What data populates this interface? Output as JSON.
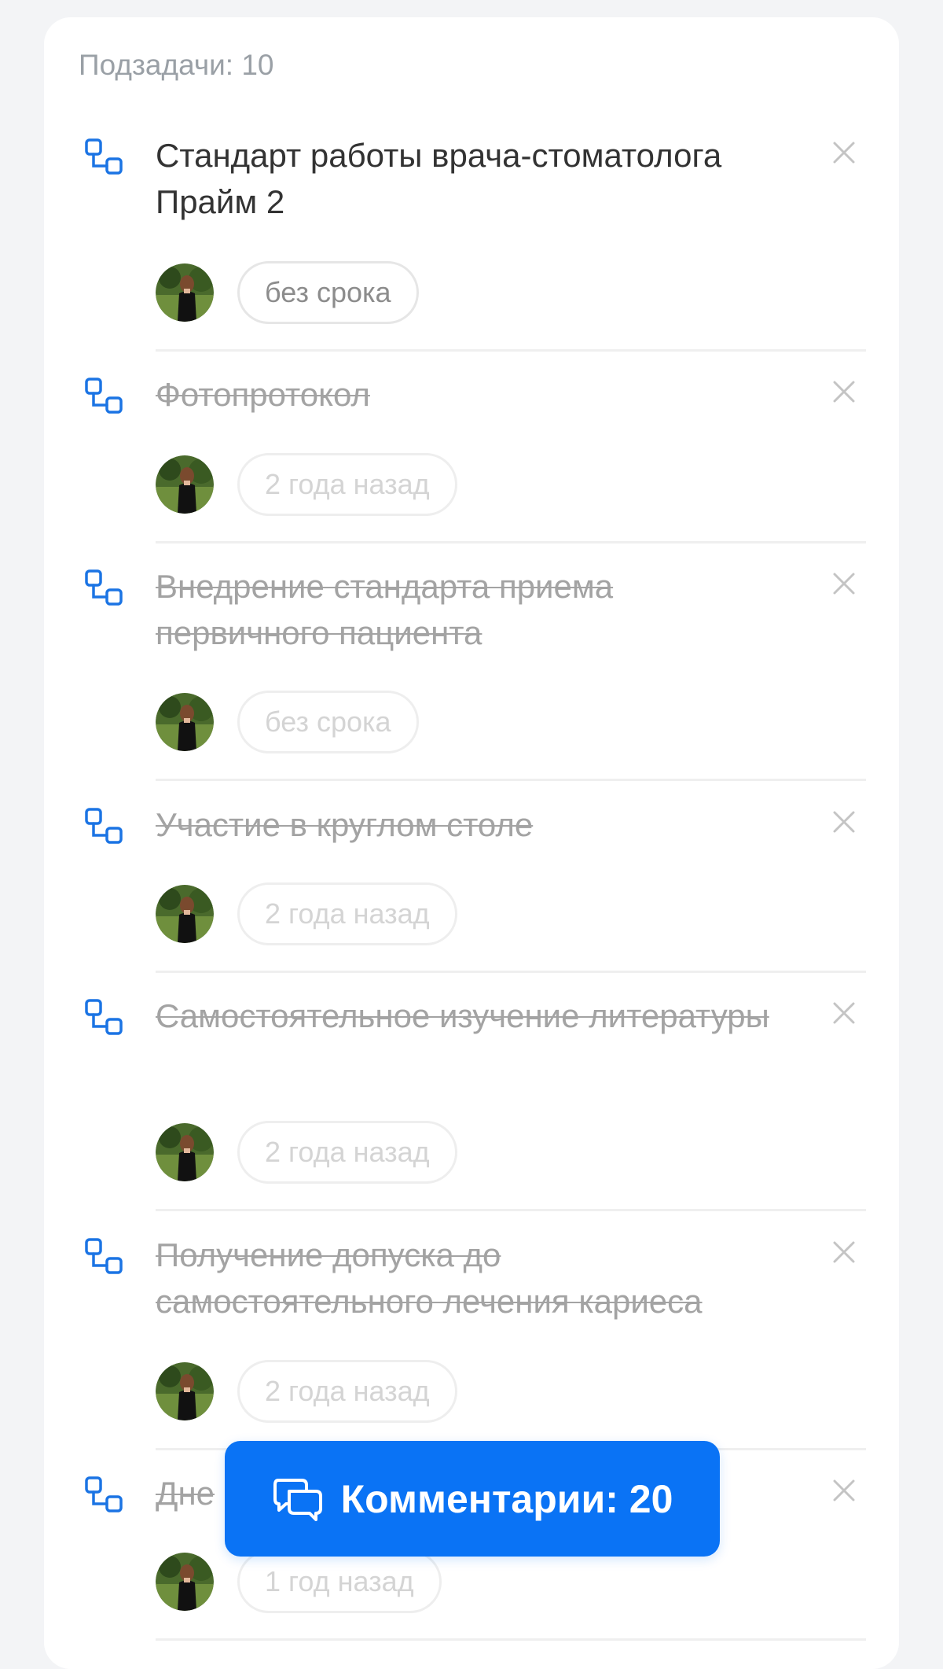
{
  "subtasks_header": {
    "label": "Подзадачи: 10"
  },
  "subtasks": [
    {
      "title": "Стандарт работы врача-стоматолога Прайм 2",
      "deadline": "без срока",
      "completed": false
    },
    {
      "title": "Фотопротокол",
      "deadline": "2 года назад",
      "completed": true
    },
    {
      "title": "Внедрение стандарта приема первичного пациента",
      "deadline": "без срока",
      "completed": true
    },
    {
      "title": "Участие в круглом столе",
      "deadline": "2 года назад",
      "completed": true
    },
    {
      "title": "Самостоятельное изучение литературы",
      "deadline": "2 года назад",
      "completed": true
    },
    {
      "title": "Получение допуска до самостоятельного лечения кариеса",
      "deadline": "2 года назад",
      "completed": true
    },
    {
      "title": "Дне",
      "deadline": "1 год назад",
      "completed": true
    }
  ],
  "comments_button": {
    "label": "Комментарии: 20"
  },
  "colors": {
    "accent": "#0a73f5",
    "subtask_icon": "#1b74e4",
    "done_text": "#a3a3a3",
    "active_text": "#333333"
  },
  "icons": {
    "subtask": "subtask-hierarchy-icon",
    "remove": "close-icon",
    "comments": "chat-bubbles-icon"
  }
}
